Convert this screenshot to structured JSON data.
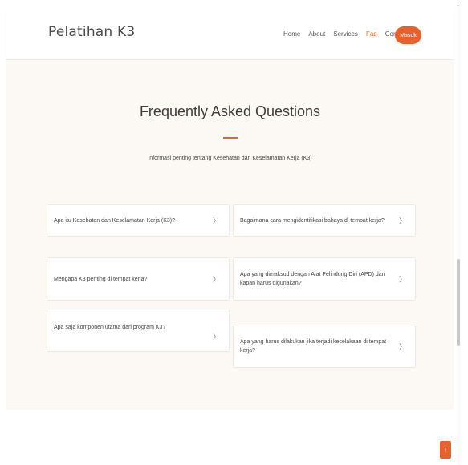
{
  "header": {
    "brand": "Pelatihan K3",
    "nav": [
      {
        "label": "Home",
        "active": false
      },
      {
        "label": "About",
        "active": false
      },
      {
        "label": "Services",
        "active": false
      },
      {
        "label": "Faq",
        "active": true
      },
      {
        "label": "Contact",
        "active": false
      }
    ],
    "cta_label": "Masuk"
  },
  "faq": {
    "title": "Frequently Asked Questions",
    "subtitle": "Informasi penting tentang Kesehatan dan Keselamatan Kerja (K3)",
    "left": [
      "Apa itu Kesehatan dan Keselamatan Kerja (K3)?",
      "Mengapa K3 penting di tempat kerja?",
      "Apa saja komponen utama dari program K3?"
    ],
    "right": [
      "Bagaimana cara mengidentifikasi bahaya di tempat kerja?",
      "Apa yang dimaksud dengan Alat Pelindung Diri (APD) dan kapan harus digunakan?",
      "Apa yang harus dilakukan jika terjadi kecelakaan di tempat kerja?"
    ],
    "chevron": "〉"
  },
  "icons": {
    "back_to_top": "arrow-up-icon",
    "chevron": "chevron-right-icon"
  },
  "colors": {
    "accent": "#e8612c",
    "section_bg": "#fcf8f4",
    "text": "#444444"
  }
}
